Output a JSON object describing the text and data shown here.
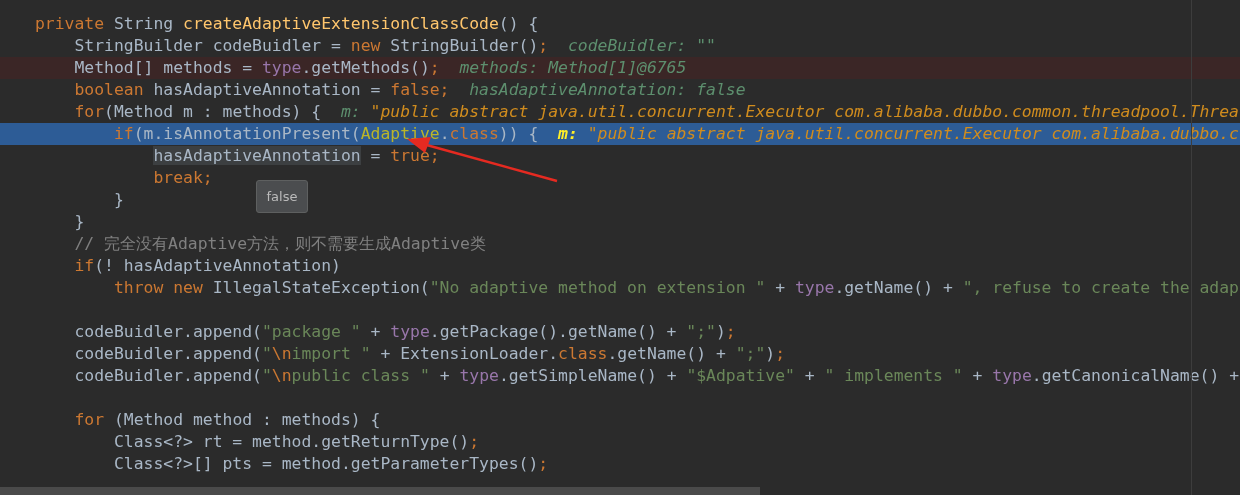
{
  "editor": {
    "lines": [
      {
        "selected": false,
        "breakpoint": false,
        "tokens": [
          {
            "kind": "kw",
            "text": "private "
          },
          {
            "kind": "plain",
            "text": "String "
          },
          {
            "kind": "decl",
            "text": "createAdaptiveExtensionClassCode"
          },
          {
            "kind": "plain",
            "text": "() {"
          }
        ]
      },
      {
        "selected": false,
        "breakpoint": false,
        "tokens": [
          {
            "kind": "plain",
            "text": "    StringBuilder codeBuidler = "
          },
          {
            "kind": "kw",
            "text": "new "
          },
          {
            "kind": "plain",
            "text": "StringBuilder()"
          },
          {
            "kind": "kw",
            "text": ";"
          }
        ],
        "inline": {
          "label": "codeBuidler:",
          "value": "\"\"",
          "kind": "value"
        }
      },
      {
        "selected": false,
        "breakpoint": true,
        "tokens": [
          {
            "kind": "plain",
            "text": "    Method[] methods = "
          },
          {
            "kind": "field",
            "text": "type"
          },
          {
            "kind": "plain",
            "text": ".getMethods()"
          },
          {
            "kind": "kw",
            "text": ";"
          }
        ],
        "inline": {
          "label": "methods:",
          "value": "Method[1]@6765",
          "kind": "value"
        }
      },
      {
        "selected": false,
        "breakpoint": false,
        "tokens": [
          {
            "kind": "kw",
            "text": "    boolean "
          },
          {
            "kind": "plain",
            "text": "hasAdaptiveAnnotation = "
          },
          {
            "kind": "kw",
            "text": "false;"
          }
        ],
        "inline": {
          "label": "hasAdaptiveAnnotation:",
          "value": "false",
          "kind": "value"
        }
      },
      {
        "selected": false,
        "breakpoint": false,
        "tokens": [
          {
            "kind": "kw",
            "text": "    for"
          },
          {
            "kind": "plain",
            "text": "(Method m : methods) {"
          }
        ],
        "inline": {
          "label": "m:",
          "value": "\"public abstract java.util.concurrent.Executor com.alibaba.dubbo.common.threadpool.Threa",
          "kind": "string"
        }
      },
      {
        "selected": true,
        "breakpoint": false,
        "tokens": [
          {
            "kind": "kw",
            "text": "        if"
          },
          {
            "kind": "plain",
            "text": "(m.isAnnotationPresent("
          },
          {
            "kind": "cls",
            "text": "Adaptive"
          },
          {
            "kind": "plain",
            "text": "."
          },
          {
            "kind": "kw",
            "text": "class"
          },
          {
            "kind": "plain",
            "text": ")) {"
          }
        ],
        "inline": {
          "label": "m:",
          "value": "\"public abstract java.util.concurrent.Executor com.alibaba.dubbo.c",
          "kind": "string"
        }
      },
      {
        "selected": false,
        "breakpoint": false,
        "tokens": [
          {
            "kind": "mark",
            "text": "            hasAdaptiveAnnotation"
          },
          {
            "kind": "plain",
            "text": " = "
          },
          {
            "kind": "kw",
            "text": "true;"
          }
        ]
      },
      {
        "selected": false,
        "breakpoint": false,
        "tokens": [
          {
            "kind": "kw",
            "text": "            break;"
          }
        ]
      },
      {
        "selected": false,
        "breakpoint": false,
        "tokens": [
          {
            "kind": "plain",
            "text": "        }"
          }
        ]
      },
      {
        "selected": false,
        "breakpoint": false,
        "tokens": [
          {
            "kind": "plain",
            "text": "    }"
          }
        ]
      },
      {
        "selected": false,
        "breakpoint": false,
        "tokens": [
          {
            "kind": "comment",
            "text": "    // 完全没有Adaptive方法，则不需要生成Adaptive类"
          }
        ]
      },
      {
        "selected": false,
        "breakpoint": false,
        "tokens": [
          {
            "kind": "kw",
            "text": "    if"
          },
          {
            "kind": "plain",
            "text": "(! hasAdaptiveAnnotation)"
          }
        ]
      },
      {
        "selected": false,
        "breakpoint": false,
        "tokens": [
          {
            "kind": "kw",
            "text": "        throw new "
          },
          {
            "kind": "plain",
            "text": "IllegalStateException("
          },
          {
            "kind": "str",
            "text": "\"No adaptive method on extension \""
          },
          {
            "kind": "plain",
            "text": " + "
          },
          {
            "kind": "field",
            "text": "type"
          },
          {
            "kind": "plain",
            "text": ".getName() + "
          },
          {
            "kind": "str",
            "text": "\", refuse to create the adap"
          }
        ]
      },
      {
        "selected": false,
        "breakpoint": false
      },
      {
        "selected": false,
        "breakpoint": false,
        "tokens": [
          {
            "kind": "plain",
            "text": "    codeBuidler.append("
          },
          {
            "kind": "str",
            "text": "\"package \""
          },
          {
            "kind": "plain",
            "text": " + "
          },
          {
            "kind": "field",
            "text": "type"
          },
          {
            "kind": "plain",
            "text": ".getPackage().getName() + "
          },
          {
            "kind": "str",
            "text": "\";\""
          },
          {
            "kind": "plain",
            "text": ")"
          },
          {
            "kind": "kw",
            "text": ";"
          }
        ]
      },
      {
        "selected": false,
        "breakpoint": false,
        "tokens": [
          {
            "kind": "plain",
            "text": "    codeBuidler.append("
          },
          {
            "kind": "str",
            "text": "\""
          },
          {
            "kind": "kw",
            "text": "\\n"
          },
          {
            "kind": "str",
            "text": "import \""
          },
          {
            "kind": "plain",
            "text": " + ExtensionLoader."
          },
          {
            "kind": "kw",
            "text": "class"
          },
          {
            "kind": "plain",
            "text": ".getName() + "
          },
          {
            "kind": "str",
            "text": "\";\""
          },
          {
            "kind": "plain",
            "text": ")"
          },
          {
            "kind": "kw",
            "text": ";"
          }
        ]
      },
      {
        "selected": false,
        "breakpoint": false,
        "tokens": [
          {
            "kind": "plain",
            "text": "    codeBuidler.append("
          },
          {
            "kind": "str",
            "text": "\""
          },
          {
            "kind": "kw",
            "text": "\\n"
          },
          {
            "kind": "str",
            "text": "public class \""
          },
          {
            "kind": "plain",
            "text": " + "
          },
          {
            "kind": "field",
            "text": "type"
          },
          {
            "kind": "plain",
            "text": ".getSimpleName() + "
          },
          {
            "kind": "str",
            "text": "\"$Adpative\""
          },
          {
            "kind": "plain",
            "text": " + "
          },
          {
            "kind": "str",
            "text": "\" implements \""
          },
          {
            "kind": "plain",
            "text": " + "
          },
          {
            "kind": "field",
            "text": "type"
          },
          {
            "kind": "plain",
            "text": ".getCanonicalName() +"
          }
        ]
      },
      {
        "selected": false,
        "breakpoint": false
      },
      {
        "selected": false,
        "breakpoint": false,
        "tokens": [
          {
            "kind": "kw",
            "text": "    for "
          },
          {
            "kind": "plain",
            "text": "(Method method : methods) {"
          }
        ]
      },
      {
        "selected": false,
        "breakpoint": false,
        "tokens": [
          {
            "kind": "plain",
            "text": "        Class<?> rt = method.getReturnType()"
          },
          {
            "kind": "kw",
            "text": ";"
          }
        ]
      },
      {
        "selected": false,
        "breakpoint": false,
        "tokens": [
          {
            "kind": "plain",
            "text": "        Class<?>[] pts = method.getParameterTypes()"
          },
          {
            "kind": "kw",
            "text": ";"
          }
        ]
      }
    ],
    "tooltip": {
      "text": "false"
    }
  }
}
